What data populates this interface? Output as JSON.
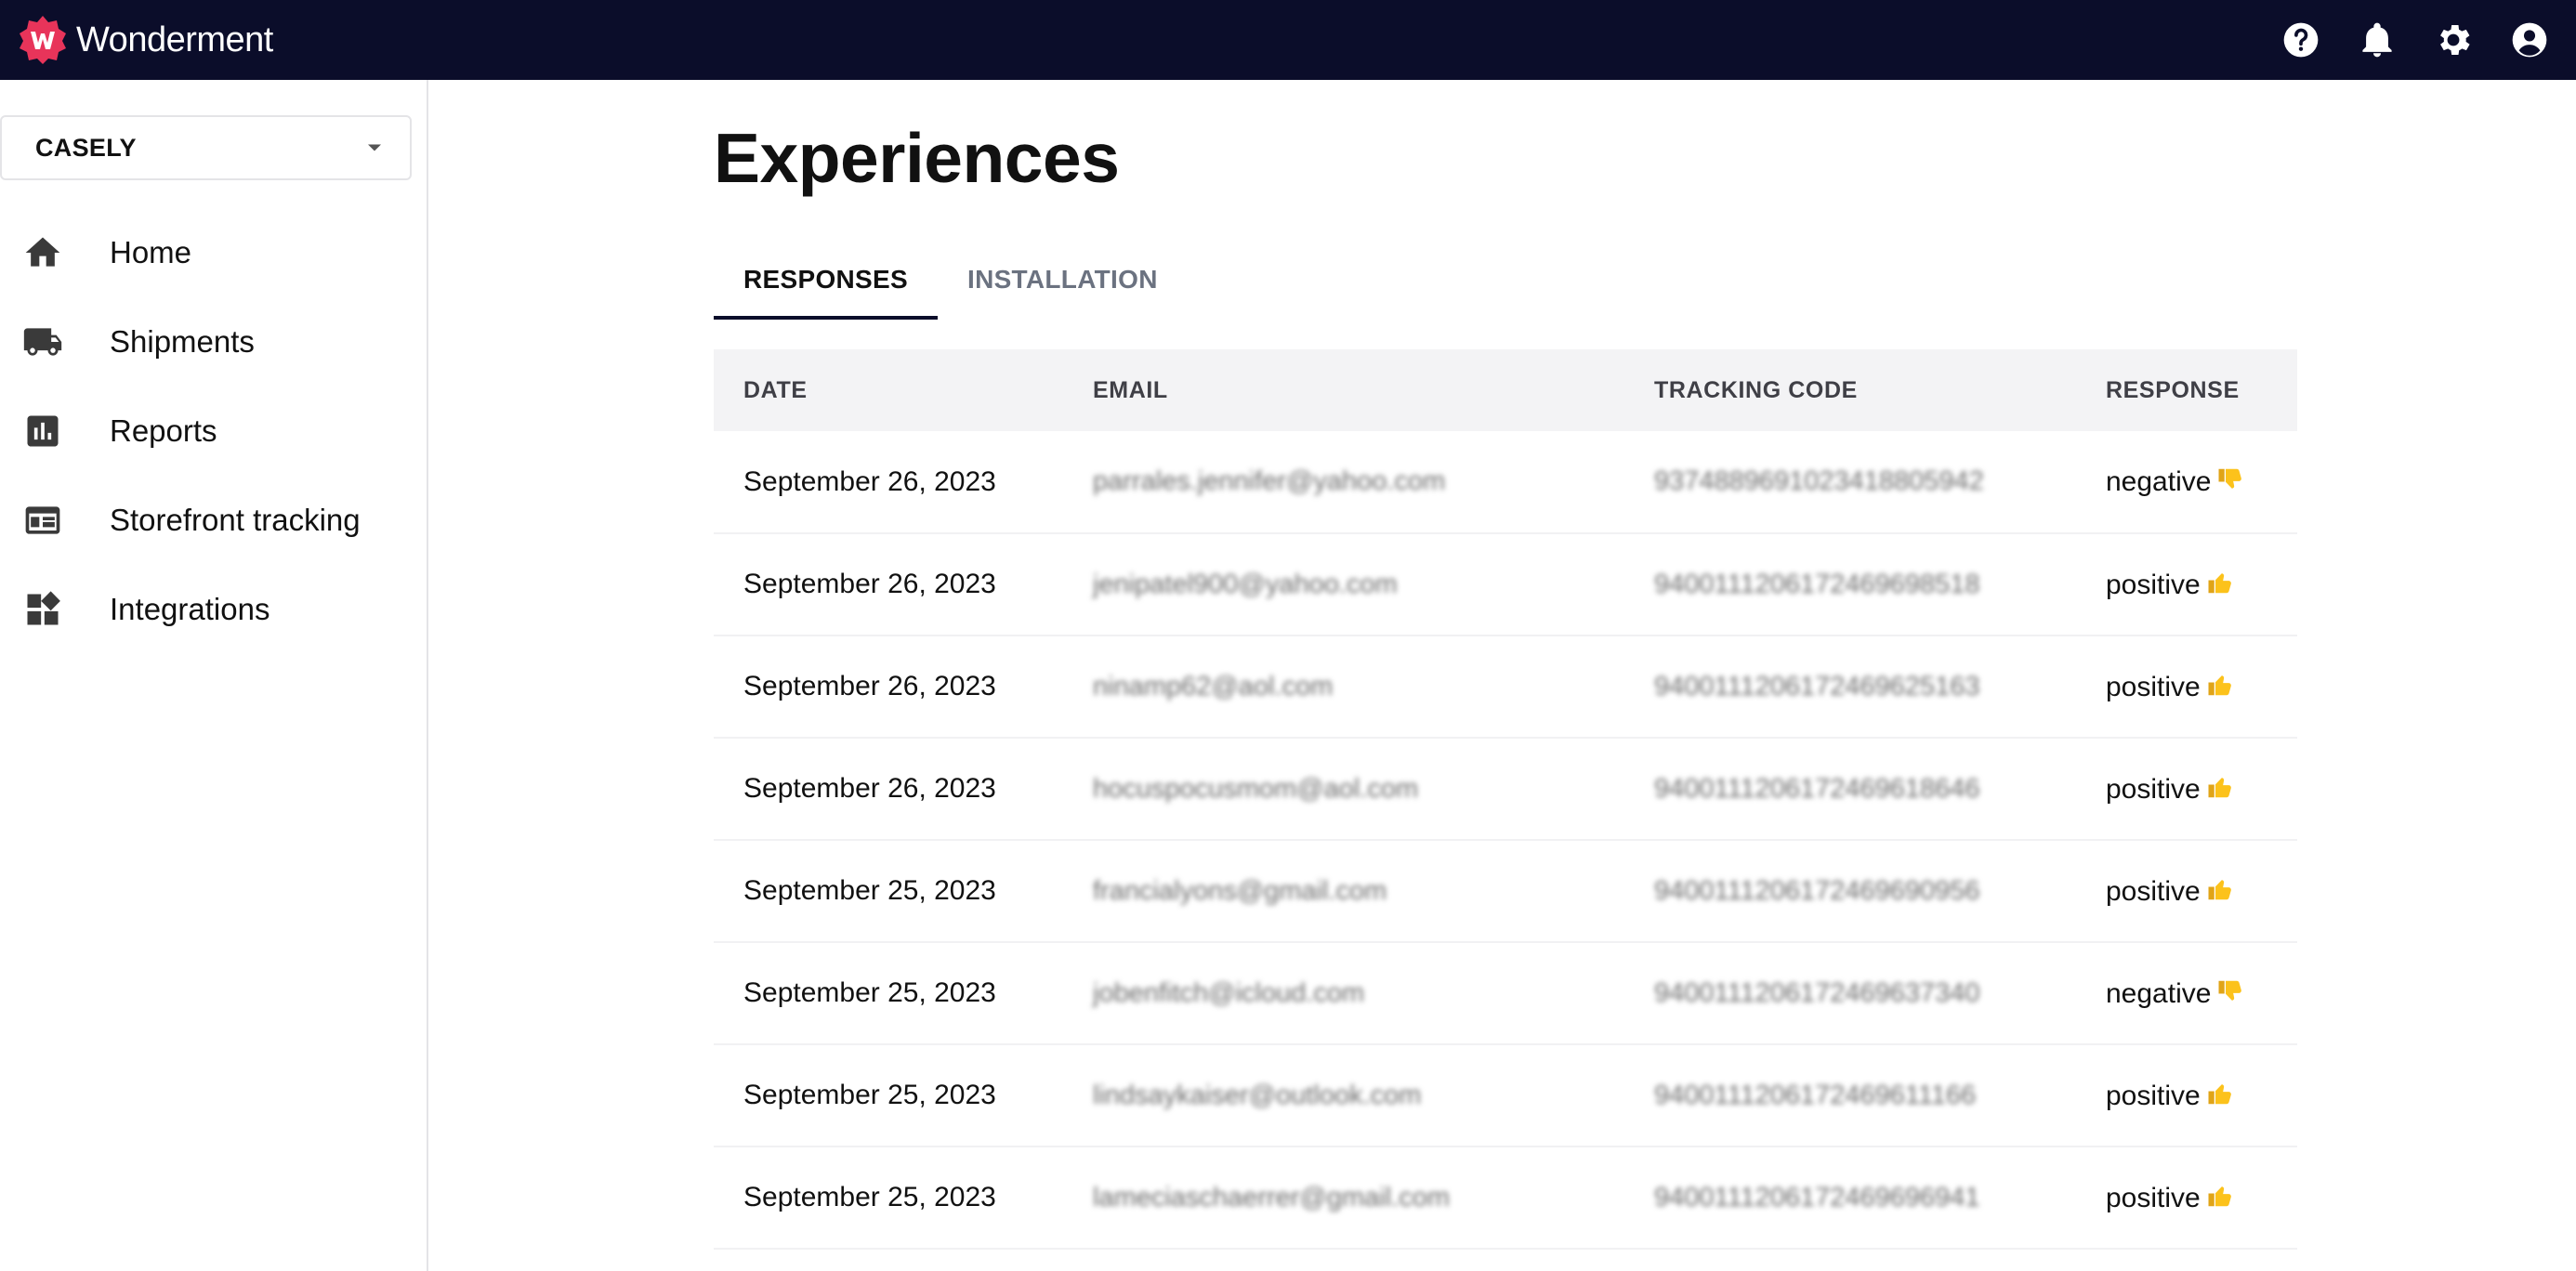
{
  "app": {
    "brand_name": "Wonderment",
    "brand_color": "#e8345a",
    "topbar_color": "#0b0d2a",
    "top_icons": [
      "help-icon",
      "bell-icon",
      "settings-icon",
      "account-icon"
    ]
  },
  "sidebar": {
    "org_selector": {
      "value": "CASELY"
    },
    "items": [
      {
        "label": "Home",
        "icon": "home-icon"
      },
      {
        "label": "Shipments",
        "icon": "truck-icon"
      },
      {
        "label": "Reports",
        "icon": "bar-chart-icon"
      },
      {
        "label": "Storefront tracking",
        "icon": "storefront-icon"
      },
      {
        "label": "Integrations",
        "icon": "widgets-icon"
      }
    ]
  },
  "main": {
    "title": "Experiences",
    "tabs": [
      {
        "label": "RESPONSES",
        "active": true
      },
      {
        "label": "INSTALLATION",
        "active": false
      }
    ],
    "table": {
      "columns": [
        "DATE",
        "EMAIL",
        "TRACKING CODE",
        "RESPONSE"
      ],
      "rows": [
        {
          "date": "September 26, 2023",
          "email": "parrales.jennifer@yahoo.com",
          "tracking": "9374889691023418805942",
          "response": "negative",
          "sentiment": "thumbs-down-icon"
        },
        {
          "date": "September 26, 2023",
          "email": "jenipatel900@yahoo.com",
          "tracking": "9400111206172469698518",
          "response": "positive",
          "sentiment": "thumbs-up-icon"
        },
        {
          "date": "September 26, 2023",
          "email": "ninamp62@aol.com",
          "tracking": "9400111206172469625163",
          "response": "positive",
          "sentiment": "thumbs-up-icon"
        },
        {
          "date": "September 26, 2023",
          "email": "hocuspocusmom@aol.com",
          "tracking": "9400111206172469618646",
          "response": "positive",
          "sentiment": "thumbs-up-icon"
        },
        {
          "date": "September 25, 2023",
          "email": "francialyons@gmail.com",
          "tracking": "9400111206172469690956",
          "response": "positive",
          "sentiment": "thumbs-up-icon"
        },
        {
          "date": "September 25, 2023",
          "email": "jobenfitch@icloud.com",
          "tracking": "9400111206172469637340",
          "response": "negative",
          "sentiment": "thumbs-down-icon"
        },
        {
          "date": "September 25, 2023",
          "email": "lindsaykaiser@outlook.com",
          "tracking": "9400111206172469611166",
          "response": "positive",
          "sentiment": "thumbs-up-icon"
        },
        {
          "date": "September 25, 2023",
          "email": "lameciaschaerrer@gmail.com",
          "tracking": "9400111206172469696941",
          "response": "positive",
          "sentiment": "thumbs-up-icon"
        }
      ]
    }
  }
}
